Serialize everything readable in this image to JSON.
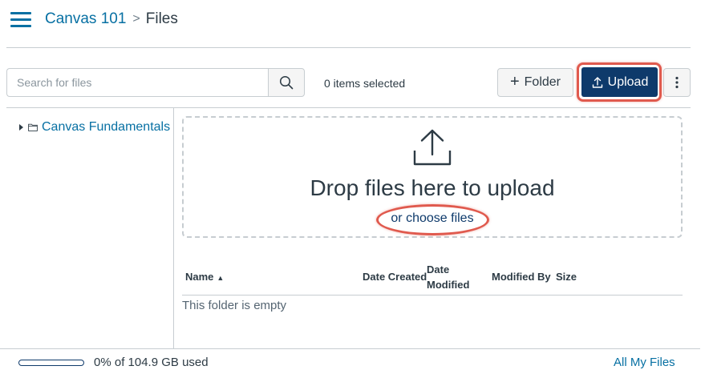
{
  "header": {
    "menu_icon": "hamburger-menu-icon",
    "breadcrumb": {
      "course": "Canvas 101",
      "separator": ">",
      "current": "Files"
    }
  },
  "toolbar": {
    "search_placeholder": "Search for files",
    "search_icon": "search-icon",
    "selected_count": "0 items selected",
    "folder_label": "Folder",
    "upload_label": "Upload",
    "more_icon": "kebab-menu-icon"
  },
  "sidebar": {
    "folders": [
      {
        "label": "Canvas Fundamentals",
        "expanded": false
      }
    ]
  },
  "dropzone": {
    "title": "Drop files here to upload",
    "choose_link": "or choose files"
  },
  "table": {
    "columns": {
      "name": "Name",
      "name_sort": "▲",
      "date_created": "Date Created",
      "date_modified": "Date Modified",
      "modified_by": "Modified By",
      "size": "Size"
    },
    "empty_message": "This folder is empty"
  },
  "footer": {
    "quota_text": "0% of 104.9 GB used",
    "quota_fraction": 0,
    "all_files_link": "All My Files"
  },
  "colors": {
    "link": "#0770a3",
    "primary": "#0e3a6b",
    "highlight": "#e05a4e",
    "border": "#c7cdd1"
  }
}
